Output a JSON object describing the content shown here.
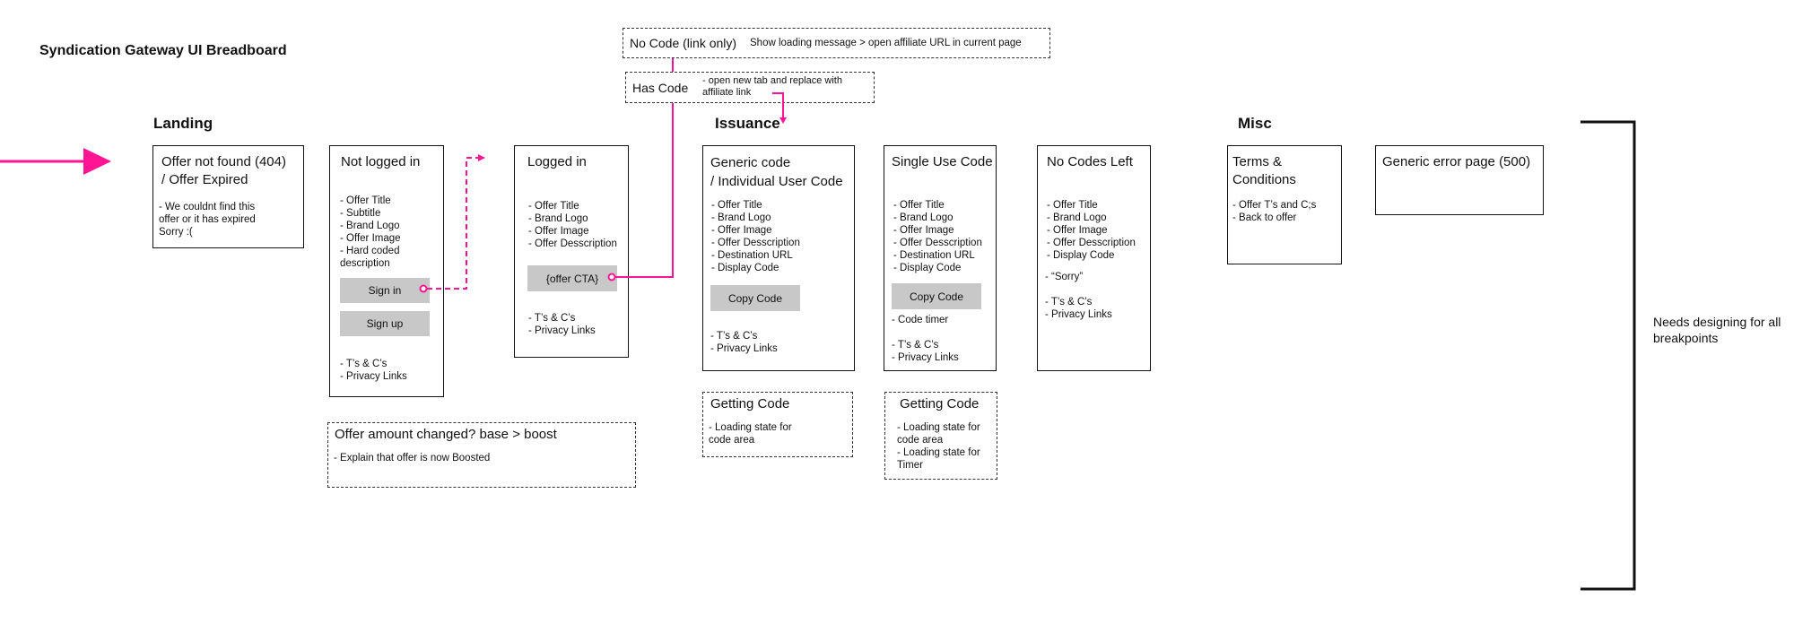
{
  "page_title": "Syndication Gateway UI Breadboard",
  "accent_color": "#ff1493",
  "sections": {
    "landing": "Landing",
    "issuance": "Issuance",
    "misc": "Misc"
  },
  "landing": {
    "offer_not_found": {
      "title": "Offer not found (404)\n / Offer Expired",
      "items": "- We couldnt find this\noffer or it has expired\nSorry :("
    },
    "not_logged_in": {
      "title": "Not logged in",
      "items": "- Offer Title\n- Subtitle\n- Brand Logo\n- Offer Image\n- Hard coded\ndescription",
      "sign_in": "Sign in",
      "sign_up": "Sign up",
      "footer": "- T’s & C’s\n- Privacy Links"
    },
    "logged_in": {
      "title": "Logged in",
      "items": "- Offer Title\n- Brand Logo\n- Offer Image\n- Offer Desscription",
      "cta": "{offer CTA}",
      "footer": "- T’s & C’s\n- Privacy Links"
    },
    "offer_changed": {
      "title": "Offer amount changed? base > boost",
      "items": "- Explain that offer is now Boosted"
    }
  },
  "flow_notes": {
    "no_code": {
      "title": "No Code (link only)",
      "text": "Show loading message > open affiliate URL in current page"
    },
    "has_code": {
      "title": "Has Code",
      "text": "- open new tab and replace with\naffiliate link"
    }
  },
  "issuance": {
    "generic_code": {
      "title": "Generic code\n/ Individual User Code",
      "items": "- Offer Title\n- Brand Logo\n- Offer Image\n- Offer Desscription\n- Destination URL\n- Display Code",
      "button": "Copy Code",
      "footer": "- T’s & C’s\n- Privacy Links"
    },
    "generic_getting_code": {
      "title": "Getting Code",
      "items": "- Loading state for\ncode area"
    },
    "single_use": {
      "title": "Single Use Code",
      "items": "- Offer Title\n- Brand Logo\n- Offer Image\n- Offer Desscription\n- Destination URL\n- Display Code",
      "button": "Copy Code",
      "timer": "- Code timer",
      "footer": "- T’s & C’s\n- Privacy Links"
    },
    "single_getting_code": {
      "title": "Getting Code",
      "items": "- Loading state for\ncode area\n- Loading state for\nTimer"
    },
    "no_codes_left": {
      "title": "No Codes Left",
      "items": "- Offer Title\n- Brand Logo\n- Offer Image\n- Offer Desscription\n- Display Code",
      "sorry": "- “Sorry”",
      "footer": "- T’s & C’s\n- Privacy Links"
    }
  },
  "misc": {
    "terms": {
      "title": "Terms & Conditions",
      "items": "- Offer T’s and C;s\n- Back to offer"
    },
    "error_500": {
      "title": "Generic error page (500)"
    }
  },
  "bracket_note": "Needs designing for all\nbreakpoints"
}
